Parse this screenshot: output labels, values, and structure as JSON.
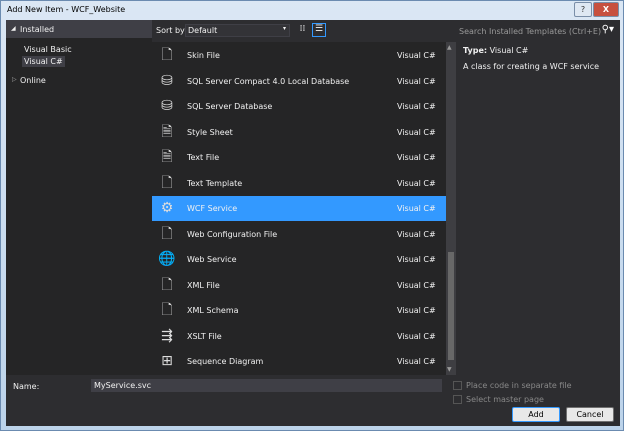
{
  "window": {
    "title": "Add New Item - WCF_Website",
    "help": "?",
    "close": "X"
  },
  "left": {
    "installed": "Installed",
    "items": [
      "Visual Basic",
      "Visual C#"
    ],
    "online": "Online"
  },
  "toolbar": {
    "sort_label": "Sort by:",
    "sort_value": "Default"
  },
  "search": {
    "placeholder": "Search Installed Templates (Ctrl+E)"
  },
  "templates": [
    {
      "name": "Skin File",
      "type": "Visual C#",
      "icon": "skin-file-icon",
      "glyph": "🗋"
    },
    {
      "name": "SQL Server Compact 4.0 Local Database",
      "type": "Visual C#",
      "icon": "database-icon",
      "glyph": "⛁"
    },
    {
      "name": "SQL Server Database",
      "type": "Visual C#",
      "icon": "database-icon",
      "glyph": "⛁"
    },
    {
      "name": "Style Sheet",
      "type": "Visual C#",
      "icon": "style-sheet-icon",
      "glyph": "🗎"
    },
    {
      "name": "Text File",
      "type": "Visual C#",
      "icon": "text-file-icon",
      "glyph": "🗎"
    },
    {
      "name": "Text Template",
      "type": "Visual C#",
      "icon": "text-template-icon",
      "glyph": "🗋"
    },
    {
      "name": "WCF Service",
      "type": "Visual C#",
      "icon": "wcf-service-icon",
      "glyph": "⚙"
    },
    {
      "name": "Web Configuration File",
      "type": "Visual C#",
      "icon": "web-config-icon",
      "glyph": "🗋"
    },
    {
      "name": "Web Service",
      "type": "Visual C#",
      "icon": "web-service-icon",
      "glyph": "🌐"
    },
    {
      "name": "XML File",
      "type": "Visual C#",
      "icon": "xml-file-icon",
      "glyph": "🗋"
    },
    {
      "name": "XML Schema",
      "type": "Visual C#",
      "icon": "xml-schema-icon",
      "glyph": "🗋"
    },
    {
      "name": "XSLT File",
      "type": "Visual C#",
      "icon": "xslt-file-icon",
      "glyph": "⇶"
    },
    {
      "name": "Sequence Diagram",
      "type": "Visual C#",
      "icon": "sequence-diagram-icon",
      "glyph": "⊞"
    }
  ],
  "selected_index": 6,
  "details": {
    "type_label": "Type:",
    "type_value": "Visual C#",
    "description": "A class for creating a WCF service"
  },
  "form": {
    "name_label": "Name:",
    "name_value": "MyService.svc",
    "place_code": "Place code in separate file",
    "master_page": "Select master page",
    "add": "Add",
    "cancel": "Cancel"
  },
  "colors": {
    "selection": "#3399ff",
    "background": "#2d2d30"
  }
}
